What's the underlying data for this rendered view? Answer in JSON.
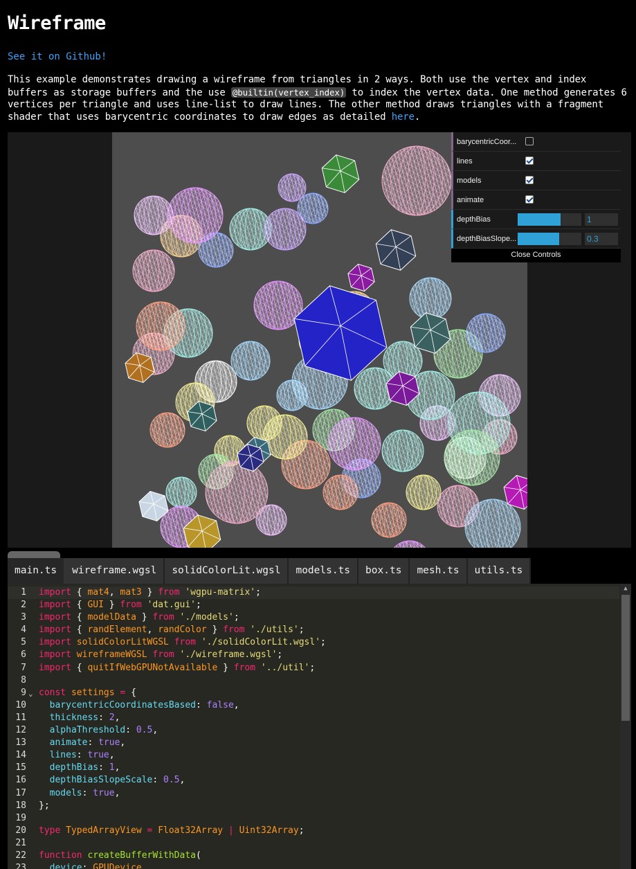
{
  "page": {
    "title": "Wireframe",
    "github_link": "See it on Github!",
    "description_before_code": "This example demonstrates drawing a wireframe from triangles in 2 ways. Both use the vertex and index buffers as storage buffers and the use ",
    "description_code": "@builtin(vertex_index)",
    "description_after_code": " to index the vertex data. One method generates 6 vertices per triangle and uses line-list to draw lines. The other method draws triangles with a fragment shader that uses barycentric coordinates to draw edges as detailed ",
    "description_link": "here",
    "description_end": "."
  },
  "gui": {
    "rows": [
      {
        "label": "barycentricCoor...",
        "type": "checkbox",
        "checked": false
      },
      {
        "label": "lines",
        "type": "checkbox",
        "checked": true
      },
      {
        "label": "models",
        "type": "checkbox",
        "checked": true
      },
      {
        "label": "animate",
        "type": "checkbox",
        "checked": true
      },
      {
        "label": "depthBias",
        "type": "number",
        "value": "1",
        "fill_fraction": 0.67
      },
      {
        "label": "depthBiasSlope...",
        "type": "number",
        "value": "0.3",
        "fill_fraction": 0.65
      }
    ],
    "close_label": "Close Controls"
  },
  "tabs": [
    "main.ts",
    "wireframe.wgsl",
    "solidColorLit.wgsl",
    "models.ts",
    "box.ts",
    "mesh.ts",
    "utils.ts"
  ],
  "active_tab": "main.ts",
  "code_lines": [
    "import { mat4, mat3 } from 'wgpu-matrix';",
    "import { GUI } from 'dat.gui';",
    "import { modelData } from './models';",
    "import { randElement, randColor } from './utils';",
    "import solidColorLitWGSL from './solidColorLit.wgsl';",
    "import wireframeWGSL from './wireframe.wgsl';",
    "import { quitIfWebGPUNotAvailable } from '../util';",
    "",
    "const settings = {",
    "  barycentricCoordinatesBased: false,",
    "  thickness: 2,",
    "  alphaThreshold: 0.5,",
    "  animate: true,",
    "  lines: true,",
    "  depthBias: 1,",
    "  depthBiasSlopeScale: 0.5,",
    "  models: true,",
    "};",
    "",
    "type TypedArrayView = Float32Array | Uint32Array;",
    "",
    "function createBufferWithData(",
    "  device: GPUDevice,"
  ],
  "colors": {
    "background": "#000000",
    "link": "#3fa2f6",
    "editor_bg": "#272822",
    "canvas_bg": "#4d4d4d",
    "gui_accent": "#2fa1d6"
  }
}
